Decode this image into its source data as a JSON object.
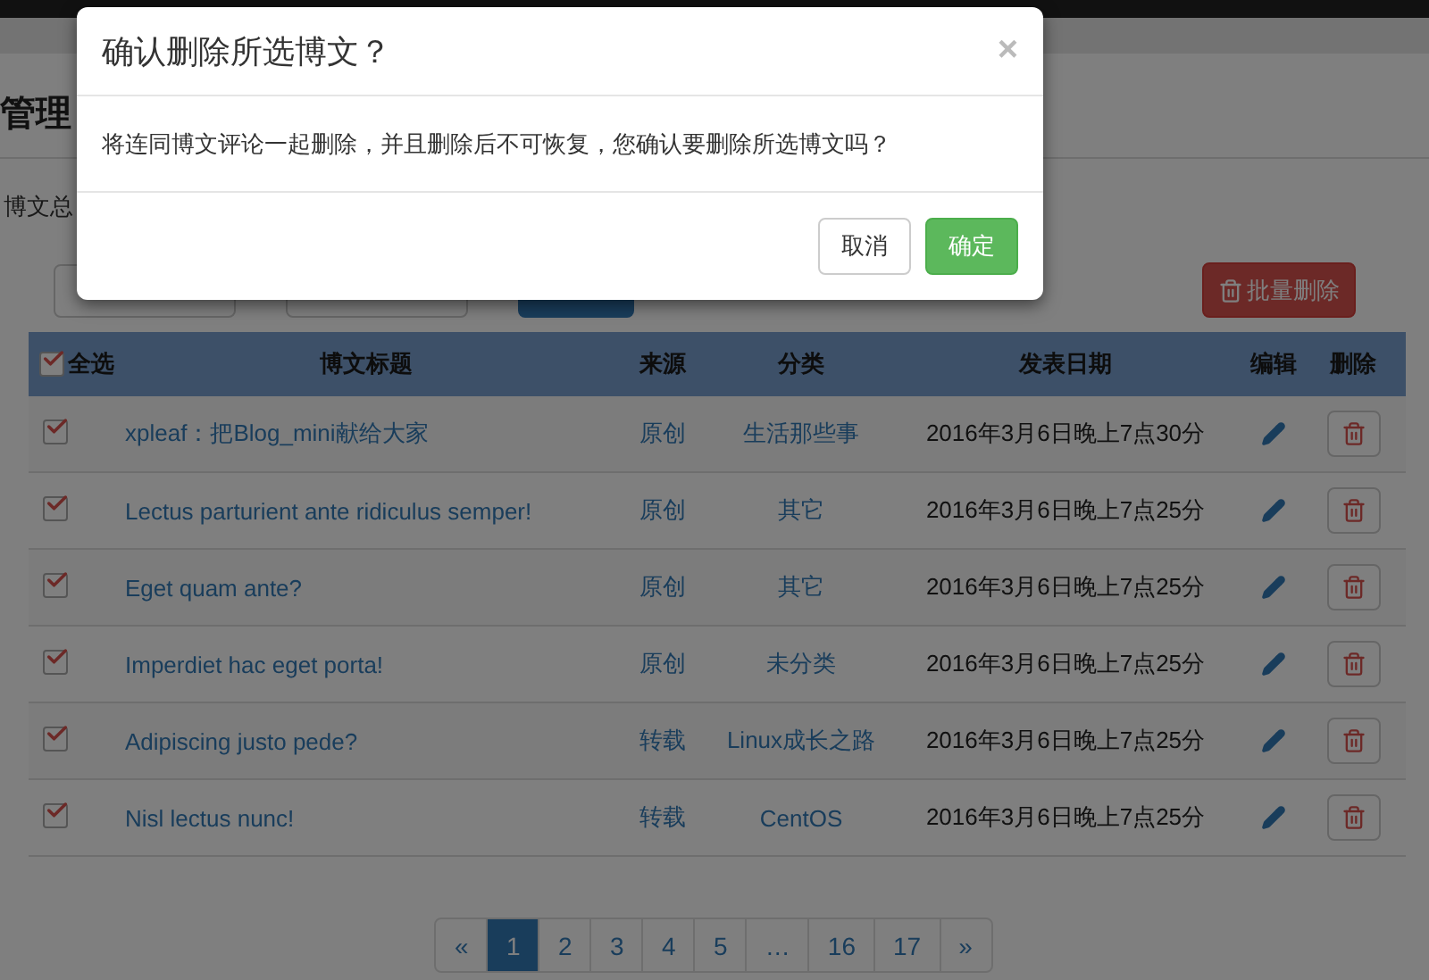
{
  "page": {
    "heading": "管理",
    "summary": "博文总",
    "batch_delete": "批量删除"
  },
  "table": {
    "select_all": {
      "label": "全选",
      "checked": true
    },
    "columns": [
      "博文标题",
      "来源",
      "分类",
      "发表日期",
      "编辑",
      "删除"
    ],
    "rows": [
      {
        "checked": true,
        "title": "xpleaf：把Blog_mini献给大家",
        "source": "原创",
        "category": "生活那些事",
        "date": "2016年3月6日晚上7点30分"
      },
      {
        "checked": true,
        "title": "Lectus parturient ante ridiculus semper!",
        "source": "原创",
        "category": "其它",
        "date": "2016年3月6日晚上7点25分"
      },
      {
        "checked": true,
        "title": "Eget quam ante?",
        "source": "原创",
        "category": "其它",
        "date": "2016年3月6日晚上7点25分"
      },
      {
        "checked": true,
        "title": "Imperdiet hac eget porta!",
        "source": "原创",
        "category": "未分类",
        "date": "2016年3月6日晚上7点25分"
      },
      {
        "checked": true,
        "title": "Adipiscing justo pede?",
        "source": "转载",
        "category": "Linux成长之路",
        "date": "2016年3月6日晚上7点25分"
      },
      {
        "checked": true,
        "title": "Nisl lectus nunc!",
        "source": "转载",
        "category": "CentOS",
        "date": "2016年3月6日晚上7点25分"
      }
    ]
  },
  "pagination": {
    "prev": "«",
    "next": "»",
    "pages": [
      {
        "label": "1",
        "selected": true
      },
      {
        "label": "2",
        "selected": false
      },
      {
        "label": "3",
        "selected": false
      },
      {
        "label": "4",
        "selected": false
      },
      {
        "label": "5",
        "selected": false
      },
      {
        "label": "…",
        "selected": false
      },
      {
        "label": "16",
        "selected": false
      },
      {
        "label": "17",
        "selected": false
      }
    ]
  },
  "modal": {
    "title": "确认删除所选博文？",
    "close": "×",
    "body": "将连同博文评论一起删除，并且删除后不可恢复，您确认要删除所选博文吗？",
    "buttons": [
      {
        "label": "取消",
        "kind": "default"
      },
      {
        "label": "确定",
        "kind": "primary"
      }
    ]
  }
}
